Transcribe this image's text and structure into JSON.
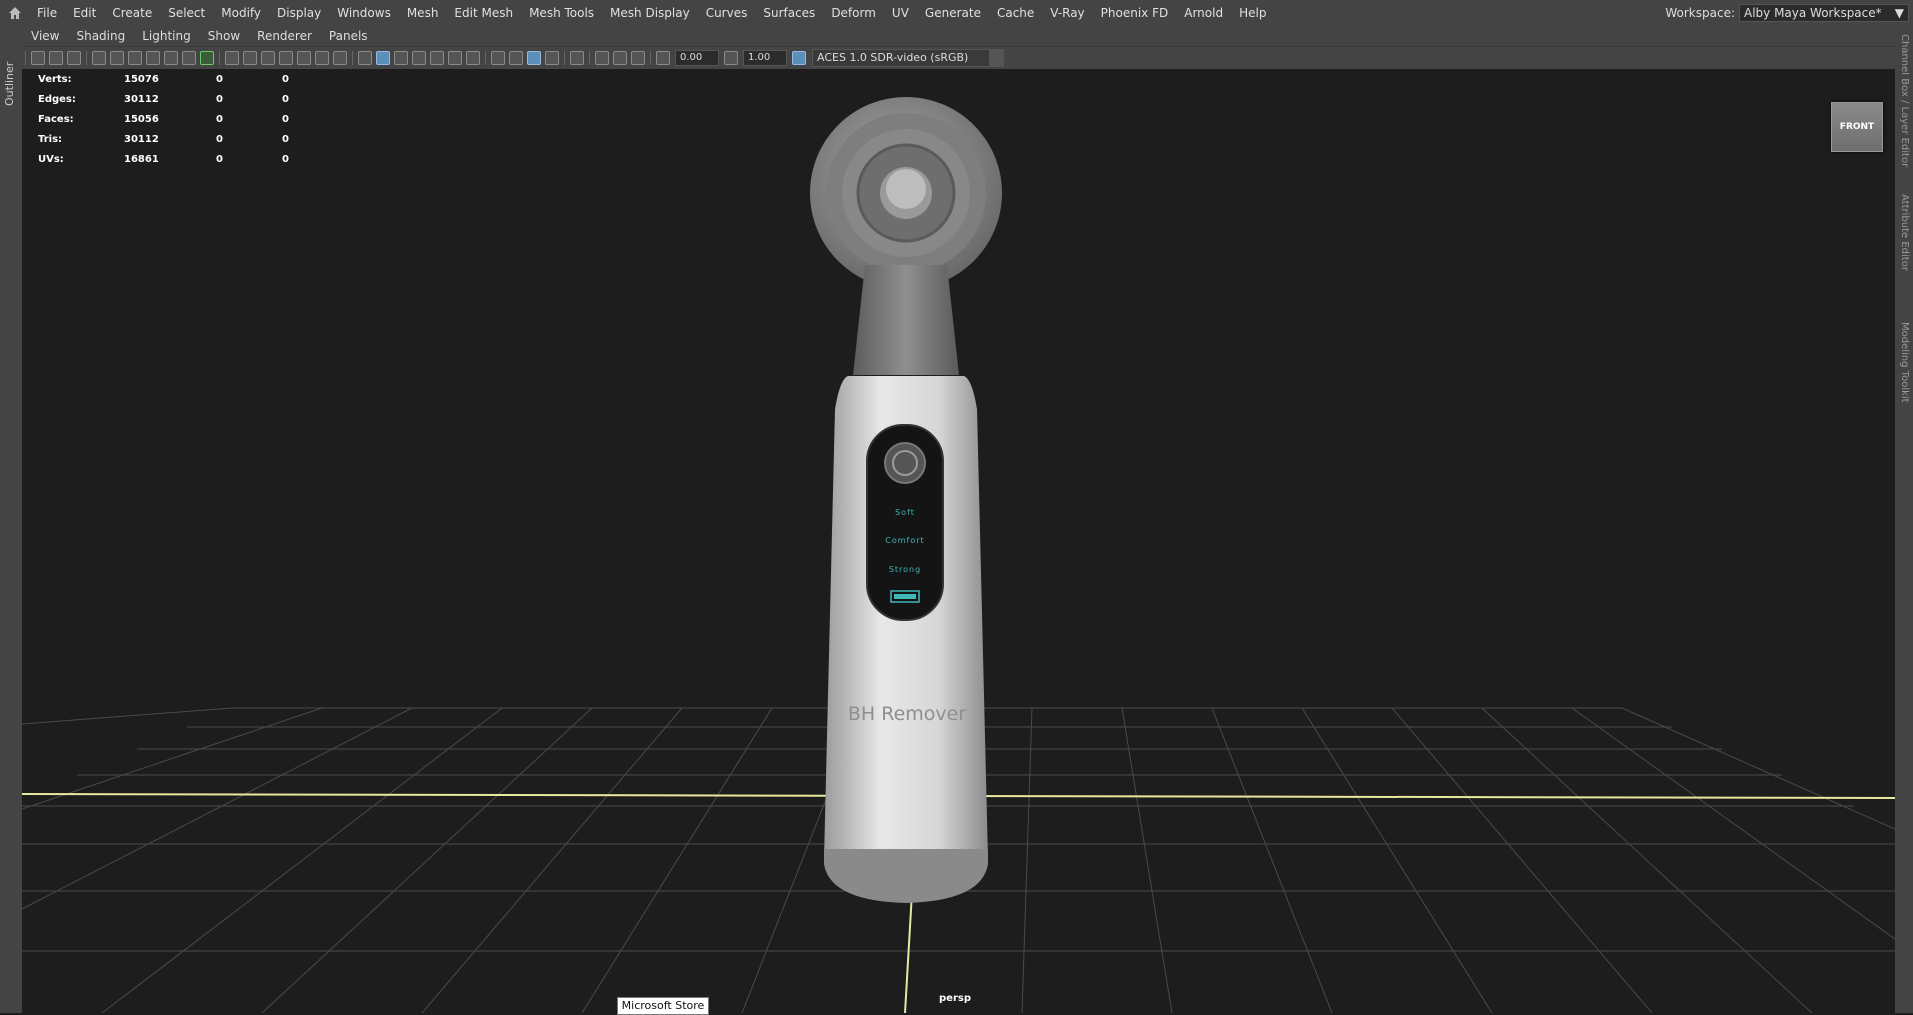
{
  "menubar": {
    "items": [
      "File",
      "Edit",
      "Create",
      "Select",
      "Modify",
      "Display",
      "Windows",
      "Mesh",
      "Edit Mesh",
      "Mesh Tools",
      "Mesh Display",
      "Curves",
      "Surfaces",
      "Deform",
      "UV",
      "Generate",
      "Cache",
      "V-Ray",
      "Phoenix FD",
      "Arnold",
      "Help"
    ],
    "workspace_label": "Workspace:",
    "workspace_value": "Alby Maya Workspace*"
  },
  "left_tabs": {
    "outliner": "Outliner"
  },
  "right_tabs": [
    "Channel Box / Layer Editor",
    "Attribute Editor",
    "Modeling Toolkit"
  ],
  "panel_menu": [
    "View",
    "Shading",
    "Lighting",
    "Show",
    "Renderer",
    "Panels"
  ],
  "toolbar": {
    "exposure": "0.00",
    "gamma": "1.00",
    "color_space": "ACES 1.0 SDR-video (sRGB)"
  },
  "hud": {
    "rows": [
      {
        "label": "Verts:",
        "v1": "15076",
        "v2": "0",
        "v3": "0"
      },
      {
        "label": "Edges:",
        "v1": "30112",
        "v2": "0",
        "v3": "0"
      },
      {
        "label": "Faces:",
        "v1": "15056",
        "v2": "0",
        "v3": "0"
      },
      {
        "label": "Tris:",
        "v1": "30112",
        "v2": "0",
        "v3": "0"
      },
      {
        "label": "UVs:",
        "v1": "16861",
        "v2": "0",
        "v3": "0"
      }
    ]
  },
  "viewcube": {
    "label": "FRONT"
  },
  "model": {
    "modes": [
      "Soft",
      "Comfort",
      "Strong"
    ],
    "brand": "BH Remover"
  },
  "viewport": {
    "camera": "persp"
  },
  "tooltip": {
    "text": "Microsoft Store"
  },
  "colors": {
    "accent_blue": "#5a8fb9",
    "grid_line": "#4a4a4a",
    "ground_axis": "#e8e89a",
    "screen_cyan": "#3fb8b8"
  }
}
